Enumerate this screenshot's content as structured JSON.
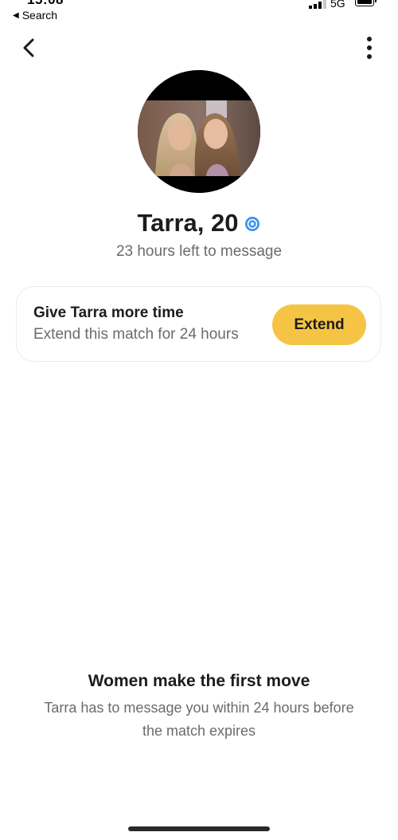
{
  "status_bar": {
    "time": "15:08",
    "back_app_label": "Search",
    "network": "5G",
    "signal_icon": "cellular-signal-icon",
    "battery_icon": "battery-icon"
  },
  "nav": {
    "back_icon": "chevron-left-icon",
    "more_icon": "vertical-dots-icon"
  },
  "profile": {
    "name_age": "Tarra, 20",
    "verified_icon": "verified-badge-icon",
    "time_left": "23 hours left to message"
  },
  "extend_card": {
    "title": "Give Tarra more time",
    "subtitle": "Extend this match for 24 hours",
    "button_label": "Extend"
  },
  "info": {
    "title": "Women make the first move",
    "text": "Tarra has to message you within 24 hours before the match expires"
  },
  "colors": {
    "accent": "#f6c445",
    "verified": "#3e8ff0",
    "muted_text": "#6b6b6b"
  }
}
